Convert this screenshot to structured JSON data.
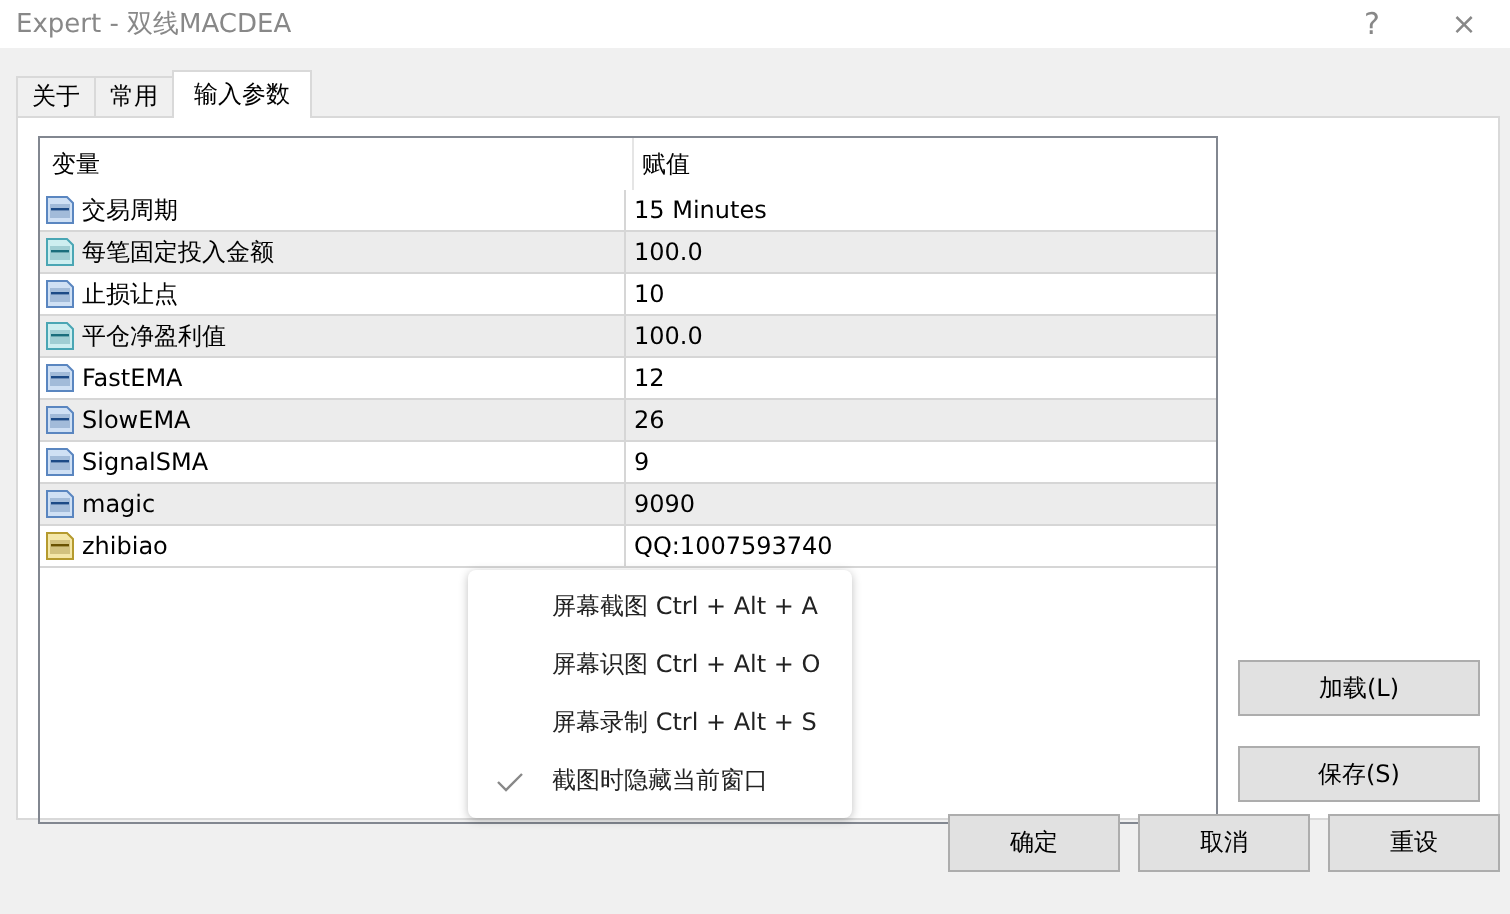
{
  "window": {
    "title": "Expert - 双线MACDEA",
    "help": "?",
    "close": "×"
  },
  "tabs": [
    {
      "label": "关于",
      "selected": false
    },
    {
      "label": "常用",
      "selected": false
    },
    {
      "label": "输入参数",
      "selected": true
    }
  ],
  "table": {
    "columns": [
      "变量",
      "赋值"
    ],
    "rows": [
      {
        "kind": "int",
        "name": "交易周期",
        "value": "15 Minutes"
      },
      {
        "kind": "double",
        "name": "每笔固定投入金额",
        "value": "100.0"
      },
      {
        "kind": "int",
        "name": "止损让点",
        "value": "10"
      },
      {
        "kind": "double",
        "name": "平仓净盈利值",
        "value": "100.0"
      },
      {
        "kind": "int",
        "name": "FastEMA",
        "value": "12"
      },
      {
        "kind": "int",
        "name": "SlowEMA",
        "value": "26"
      },
      {
        "kind": "int",
        "name": "SignalSMA",
        "value": "9"
      },
      {
        "kind": "int",
        "name": "magic",
        "value": "9090"
      },
      {
        "kind": "string",
        "name": "zhibiao",
        "value": "QQ:1007593740"
      }
    ]
  },
  "side_buttons": [
    "加载(L)",
    "保存(S)"
  ],
  "buttons": [
    "确定",
    "取消",
    "重设"
  ],
  "context_menu": [
    {
      "label": "屏幕截图 Ctrl + Alt + A",
      "checked": false
    },
    {
      "label": "屏幕识图 Ctrl + Alt + O",
      "checked": false
    },
    {
      "label": "屏幕录制 Ctrl + Alt + S",
      "checked": false
    },
    {
      "label": "截图时隐藏当前窗口",
      "checked": true
    }
  ]
}
